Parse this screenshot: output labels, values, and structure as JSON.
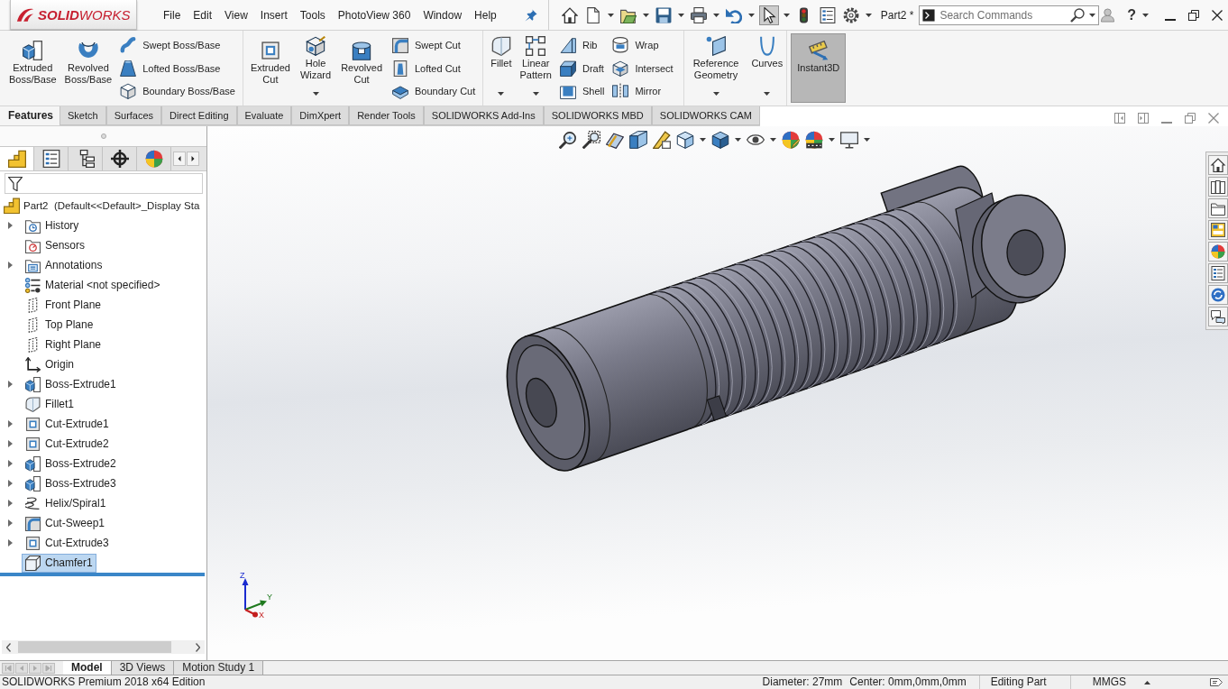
{
  "app": {
    "logo": "**SOLID**WORKS",
    "menu": [
      "File",
      "Edit",
      "View",
      "Insert",
      "Tools",
      "PhotoView 360",
      "Window",
      "Help"
    ],
    "quick_access": [
      {
        "dropdown": false,
        "on": false
      },
      {
        "dropdown": true,
        "on": false
      },
      {
        "dropdown": true,
        "on": false
      },
      {
        "dropdown": true,
        "on": false
      },
      {
        "dropdown": true,
        "on": false
      },
      {
        "dropdown": true,
        "on": false
      },
      {
        "dropdown": true,
        "on": true
      },
      {
        "dropdown": false,
        "on": false
      },
      {
        "dropdown": false,
        "on": false
      },
      {
        "dropdown": true,
        "on": false
      }
    ],
    "document": "Part2 *",
    "search": {
      "placeholder": "Search Commands"
    },
    "help": "?"
  },
  "ribbon": [
    {
      "columns": [
        {
          "kind": "large",
          "label": "Extruded Boss/Base",
          "dropdown": false,
          "on": false
        },
        {
          "kind": "large",
          "label": "Revolved Boss/Base",
          "dropdown": false,
          "on": false
        },
        {
          "kind": "stack",
          "buttons": [
            "Swept Boss/Base",
            "Lofted Boss/Base",
            "Boundary Boss/Base"
          ]
        }
      ]
    },
    {
      "columns": [
        {
          "kind": "large",
          "label": "Extruded Cut",
          "dropdown": false,
          "on": false
        },
        {
          "kind": "large",
          "label": "Hole Wizard",
          "dropdown": true,
          "on": false
        },
        {
          "kind": "large",
          "label": "Revolved Cut",
          "dropdown": false,
          "on": false
        },
        {
          "kind": "stack",
          "buttons": [
            "Swept Cut",
            "Lofted Cut",
            "Boundary Cut"
          ]
        }
      ]
    },
    {
      "columns": [
        {
          "kind": "large",
          "label": "Fillet",
          "dropdown": true,
          "on": false
        },
        {
          "kind": "large",
          "label": "Linear Pattern",
          "dropdown": true,
          "on": false
        },
        {
          "kind": "stack",
          "buttons": [
            "Rib",
            "Draft",
            "Shell"
          ]
        },
        {
          "kind": "stack",
          "buttons": [
            "Wrap",
            "Intersect",
            "Mirror"
          ]
        }
      ]
    },
    {
      "columns": [
        {
          "kind": "large",
          "label": "Reference Geometry",
          "dropdown": true,
          "on": false
        },
        {
          "kind": "large",
          "label": "Curves",
          "dropdown": true,
          "on": false
        }
      ]
    },
    {
      "columns": [
        {
          "kind": "large",
          "label": "Instant3D",
          "dropdown": false,
          "on": true
        }
      ]
    }
  ],
  "command_tabs": [
    {
      "label": "Features",
      "selected": true
    },
    {
      "label": "Sketch",
      "selected": false
    },
    {
      "label": "Surfaces",
      "selected": false
    },
    {
      "label": "Direct Editing",
      "selected": false
    },
    {
      "label": "Evaluate",
      "selected": false
    },
    {
      "label": "DimXpert",
      "selected": false
    },
    {
      "label": "Render Tools",
      "selected": false
    },
    {
      "label": "SOLIDWORKS Add-Ins",
      "selected": false
    },
    {
      "label": "SOLIDWORKS MBD",
      "selected": false
    },
    {
      "label": "SOLIDWORKS CAM",
      "selected": false
    }
  ],
  "feature_manager": {
    "tabs": [
      {
        "selected": true
      },
      {
        "selected": false
      },
      {
        "selected": false
      },
      {
        "selected": false
      },
      {
        "selected": false
      }
    ],
    "root": "Part2  (Default<<Default>_Display Sta",
    "items": [
      {
        "label": "History",
        "kind": "history",
        "collapsed": true,
        "selected": false
      },
      {
        "label": "Sensors",
        "kind": "sensors",
        "collapsed": false,
        "selected": false
      },
      {
        "label": "Annotations",
        "kind": "annotations",
        "collapsed": true,
        "selected": false
      },
      {
        "label": "Material <not specified>",
        "kind": "material",
        "collapsed": false,
        "selected": false
      },
      {
        "label": "Front Plane",
        "kind": "plane",
        "collapsed": false,
        "selected": false
      },
      {
        "label": "Top Plane",
        "kind": "plane",
        "collapsed": false,
        "selected": false
      },
      {
        "label": "Right Plane",
        "kind": "plane",
        "collapsed": false,
        "selected": false
      },
      {
        "label": "Origin",
        "kind": "origin",
        "collapsed": false,
        "selected": false
      },
      {
        "label": "Boss-Extrude1",
        "kind": "boss",
        "collapsed": true,
        "selected": false
      },
      {
        "label": "Fillet1",
        "kind": "fillet",
        "collapsed": false,
        "selected": false
      },
      {
        "label": "Cut-Extrude1",
        "kind": "cut",
        "collapsed": true,
        "selected": false
      },
      {
        "label": "Cut-Extrude2",
        "kind": "cut",
        "collapsed": true,
        "selected": false
      },
      {
        "label": "Boss-Extrude2",
        "kind": "boss",
        "collapsed": true,
        "selected": false
      },
      {
        "label": "Boss-Extrude3",
        "kind": "boss",
        "collapsed": true,
        "selected": false
      },
      {
        "label": "Helix/Spiral1",
        "kind": "helix",
        "collapsed": true,
        "selected": false
      },
      {
        "label": "Cut-Sweep1",
        "kind": "sweep",
        "collapsed": true,
        "selected": false
      },
      {
        "label": "Cut-Extrude3",
        "kind": "cut",
        "collapsed": true,
        "selected": false
      },
      {
        "label": "Chamfer1",
        "kind": "chamfer",
        "collapsed": false,
        "selected": true
      }
    ]
  },
  "view_toolbar": [
    {
      "dropdown": false
    },
    {
      "dropdown": false
    },
    {
      "dropdown": false
    },
    {
      "dropdown": false
    },
    {
      "dropdown": false
    },
    {
      "dropdown": true
    },
    {
      "dropdown": true
    },
    {
      "dropdown": true
    },
    {
      "dropdown": false
    },
    {
      "dropdown": true
    },
    {
      "dropdown": true
    }
  ],
  "triad": [
    "Z",
    "Y",
    "X"
  ],
  "bottom_tabs": [
    {
      "label": "Model",
      "selected": true
    },
    {
      "label": "3D Views",
      "selected": false
    },
    {
      "label": "Motion Study 1",
      "selected": false
    }
  ],
  "status_bar": {
    "edition": "SOLIDWORKS Premium 2018 x64 Edition",
    "measure": [
      "Diameter: 27mm",
      "Center: 0mm,0mm,0mm"
    ],
    "mode": "Editing Part",
    "units": "MMGS"
  }
}
